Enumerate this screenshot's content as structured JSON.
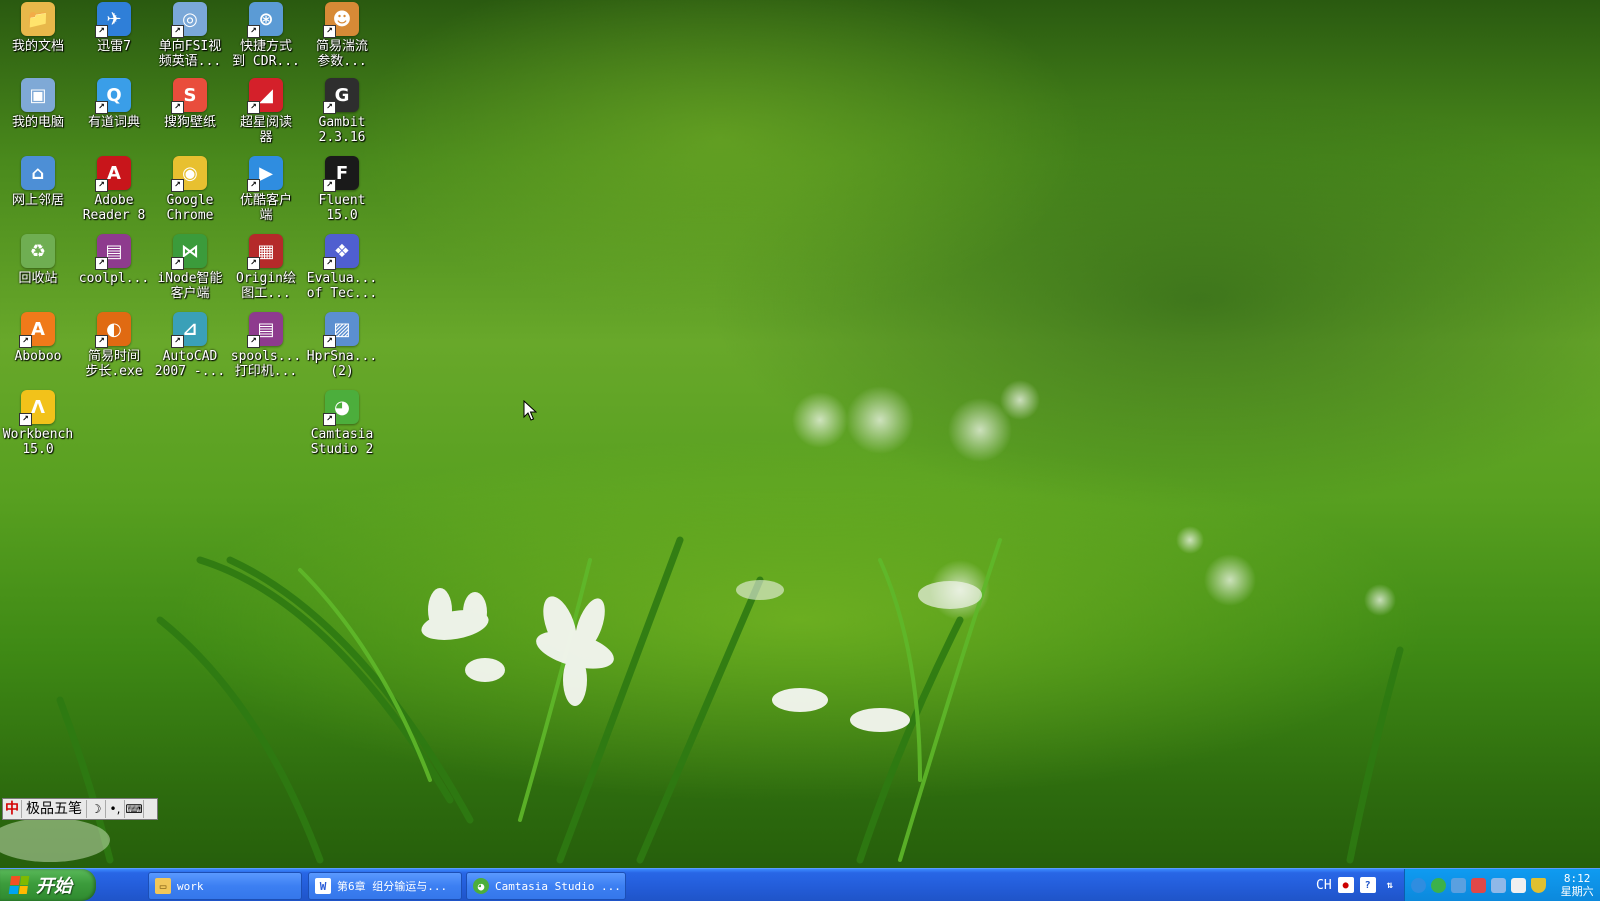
{
  "desktop": {
    "icons": [
      {
        "label": "我的文档",
        "icon": "folder-documents-icon",
        "color": "#e8b84a",
        "glyph": "📁",
        "col": 0,
        "row": 0
      },
      {
        "label": "迅雷7",
        "icon": "thunder-bird-icon",
        "color": "#2f7fd8",
        "glyph": "✈",
        "col": 1,
        "row": 0
      },
      {
        "label": "单向FSI视\n频英语...",
        "icon": "swf-file-icon",
        "color": "#7aa8d8",
        "glyph": "◎",
        "col": 2,
        "row": 0
      },
      {
        "label": "快捷方式\n到 CDR...",
        "icon": "cdr-shortcut-icon",
        "color": "#5b9bd5",
        "glyph": "⊛",
        "col": 3,
        "row": 0
      },
      {
        "label": "简易湍流\n参数...",
        "icon": "tiger-mascot-icon",
        "color": "#d78a36",
        "glyph": "☻",
        "col": 4,
        "row": 0
      },
      {
        "label": "我的电脑",
        "icon": "my-computer-icon",
        "color": "#7fa9d6",
        "glyph": "▣",
        "col": 0,
        "row": 1
      },
      {
        "label": "有道词典",
        "icon": "youdao-dict-icon",
        "color": "#3a9ee8",
        "glyph": "Q",
        "col": 1,
        "row": 1
      },
      {
        "label": "搜狗壁纸",
        "icon": "sogou-wallpaper-icon",
        "color": "#e94d3c",
        "glyph": "S",
        "col": 2,
        "row": 1
      },
      {
        "label": "超星阅读\n器",
        "icon": "chaoxing-reader-icon",
        "color": "#d4202a",
        "glyph": "◢",
        "col": 3,
        "row": 1
      },
      {
        "label": "Gambit\n2.3.16",
        "icon": "gambit-icon",
        "color": "#2e2e2e",
        "glyph": "G",
        "col": 4,
        "row": 1
      },
      {
        "label": "网上邻居",
        "icon": "network-places-icon",
        "color": "#4d8fd6",
        "glyph": "⌂",
        "col": 0,
        "row": 2
      },
      {
        "label": "Adobe\nReader 8",
        "icon": "adobe-reader-icon",
        "color": "#c8151b",
        "glyph": "A",
        "col": 1,
        "row": 2
      },
      {
        "label": "Google\nChrome",
        "icon": "chrome-icon",
        "color": "#e8c030",
        "glyph": "◉",
        "col": 2,
        "row": 2
      },
      {
        "label": "优酷客户\n端",
        "icon": "youku-client-icon",
        "color": "#2f8de0",
        "glyph": "▶",
        "col": 3,
        "row": 2
      },
      {
        "label": "Fluent\n15.0",
        "icon": "fluent-icon",
        "color": "#1a1a1a",
        "glyph": "F",
        "col": 4,
        "row": 2
      },
      {
        "label": "回收站",
        "icon": "recycle-bin-icon",
        "color": "#6fae52",
        "glyph": "♻",
        "col": 0,
        "row": 3
      },
      {
        "label": "coolpl...",
        "icon": "winrar-archive-icon",
        "color": "#8e3b8e",
        "glyph": "▤",
        "col": 1,
        "row": 3
      },
      {
        "label": "iNode智能\n客户端",
        "icon": "inode-client-icon",
        "color": "#3b9b3b",
        "glyph": "⋈",
        "col": 2,
        "row": 3
      },
      {
        "label": "Origin绘\n图工...",
        "icon": "origin-plot-icon",
        "color": "#b52a2a",
        "glyph": "▦",
        "col": 3,
        "row": 3
      },
      {
        "label": "Evalua...\nof Tec...",
        "icon": "molecule-icon",
        "color": "#4f5fd0",
        "glyph": "❖",
        "col": 4,
        "row": 3
      },
      {
        "label": "Aboboo",
        "icon": "aboboo-icon",
        "color": "#f07a1a",
        "glyph": "A",
        "col": 0,
        "row": 4
      },
      {
        "label": "简易时间\n步长.exe",
        "icon": "firefox-icon",
        "color": "#e06a12",
        "glyph": "◐",
        "col": 1,
        "row": 4
      },
      {
        "label": "AutoCAD\n2007 -...",
        "icon": "autocad-icon",
        "color": "#3aa0b8",
        "glyph": "⊿",
        "col": 2,
        "row": 4
      },
      {
        "label": "spools...\n打印机...",
        "icon": "winrar-archive-icon",
        "color": "#8e3b8e",
        "glyph": "▤",
        "col": 3,
        "row": 4
      },
      {
        "label": "HprSna...\n(2)",
        "icon": "hprsnap-icon",
        "color": "#5b8fd0",
        "glyph": "▨",
        "col": 4,
        "row": 4
      },
      {
        "label": "Workbench\n15.0",
        "icon": "ansys-workbench-icon",
        "color": "#f2c21a",
        "glyph": "Λ",
        "col": 0,
        "row": 5
      },
      {
        "label": "Camtasia\nStudio 2",
        "icon": "camtasia-icon",
        "color": "#4cae3c",
        "glyph": "◕",
        "col": 4,
        "row": 5
      }
    ]
  },
  "ime": {
    "mode_char": "中",
    "name": "极品五笔",
    "half_full": "☽",
    "punct": "•,",
    "keyboard": "⌨"
  },
  "taskbar": {
    "start_label": "开始",
    "tasks": [
      {
        "label": "work",
        "icon": "folder-icon",
        "color": "#f1c75a",
        "glyph": "▭"
      },
      {
        "label": "第6章 组分输运与...",
        "icon": "word-doc-icon",
        "color": "#ffffff",
        "glyph": "W"
      },
      {
        "label": "Camtasia Studio ...",
        "icon": "camtasia-icon",
        "color": "#4cae3c",
        "glyph": "◕"
      }
    ],
    "lang": "CH",
    "clock_time": "8:12",
    "clock_day": "星期六"
  }
}
